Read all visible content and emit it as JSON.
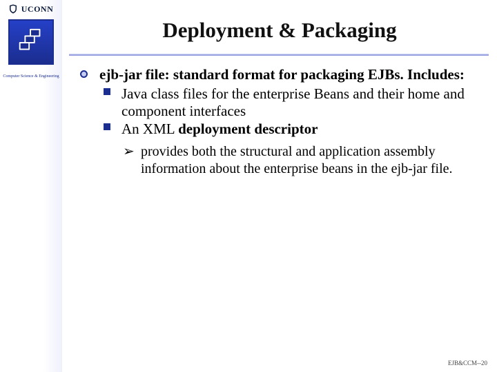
{
  "brand": {
    "name": "UCONN",
    "seal_caption": "Computer Science & Engineering"
  },
  "title": "Deployment & Packaging",
  "content": {
    "lvl1_bold": "ejb-jar",
    "lvl1_rest": " file: standard format for packaging EJBs. Includes:",
    "lvl2_a": "Java class files for the enterprise Beans and their home and component interfaces",
    "lvl2_b_pre": "An XML ",
    "lvl2_b_bold": "deployment descriptor",
    "lvl3": "provides both the structural and application assembly information about the enterprise beans in the ejb-jar file."
  },
  "footer": "EJB&CCM--20"
}
